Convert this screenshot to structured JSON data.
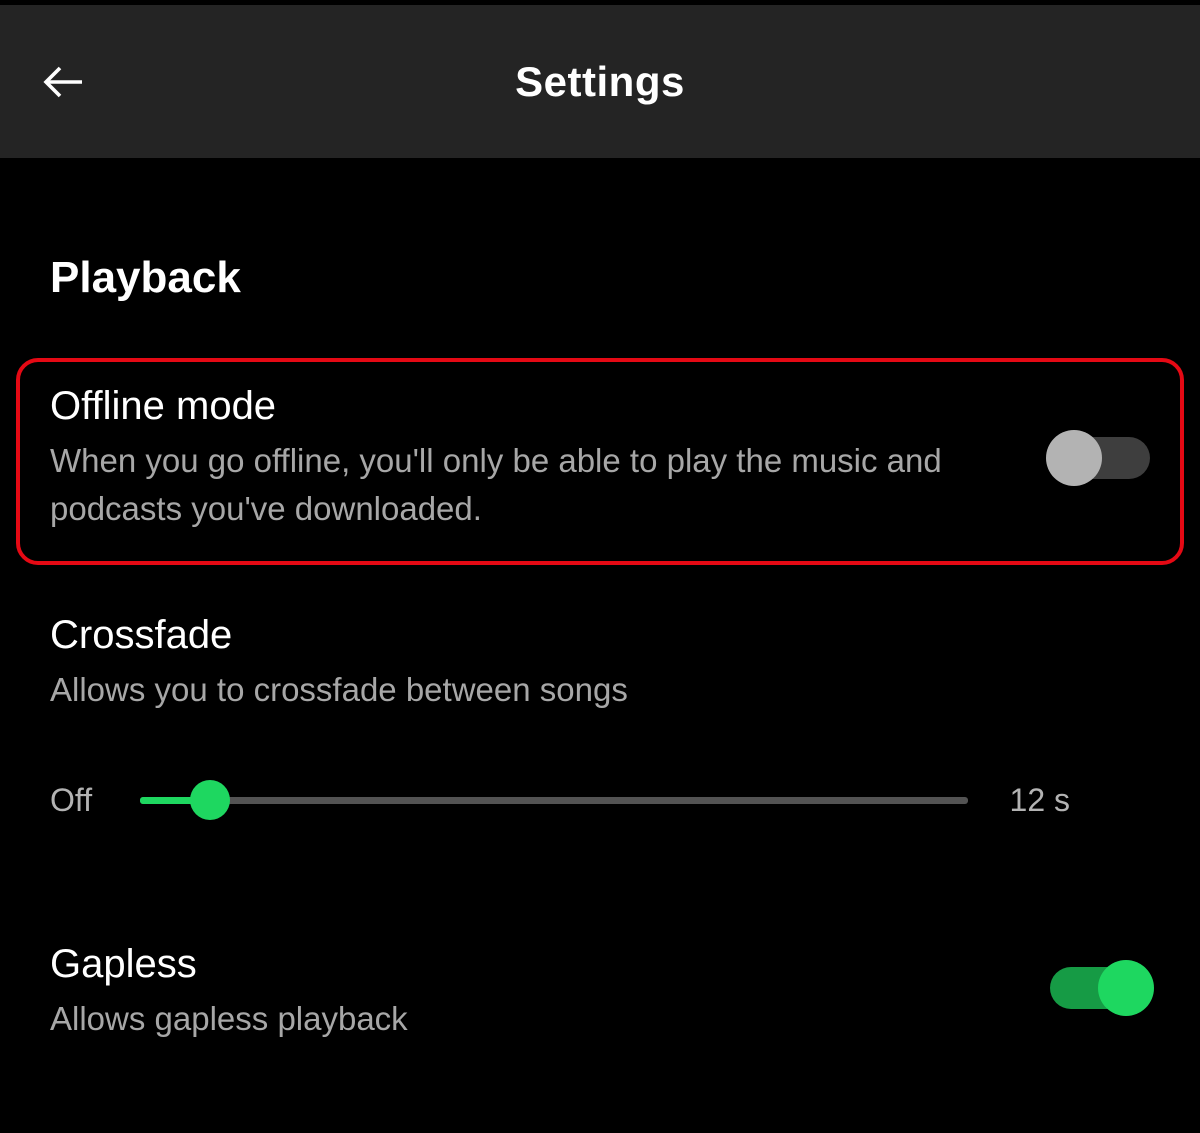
{
  "header": {
    "title": "Settings"
  },
  "playback": {
    "section_title": "Playback",
    "offline": {
      "label": "Offline mode",
      "desc": "When you go offline, you'll only be able to play the music and podcasts you've downloaded.",
      "enabled": false
    },
    "crossfade": {
      "label": "Crossfade",
      "desc": "Allows you to crossfade between songs",
      "min_label": "Off",
      "max_label": "12 s",
      "value_percent": 8.5
    },
    "gapless": {
      "label": "Gapless",
      "desc": "Allows gapless playback",
      "enabled": true
    }
  }
}
